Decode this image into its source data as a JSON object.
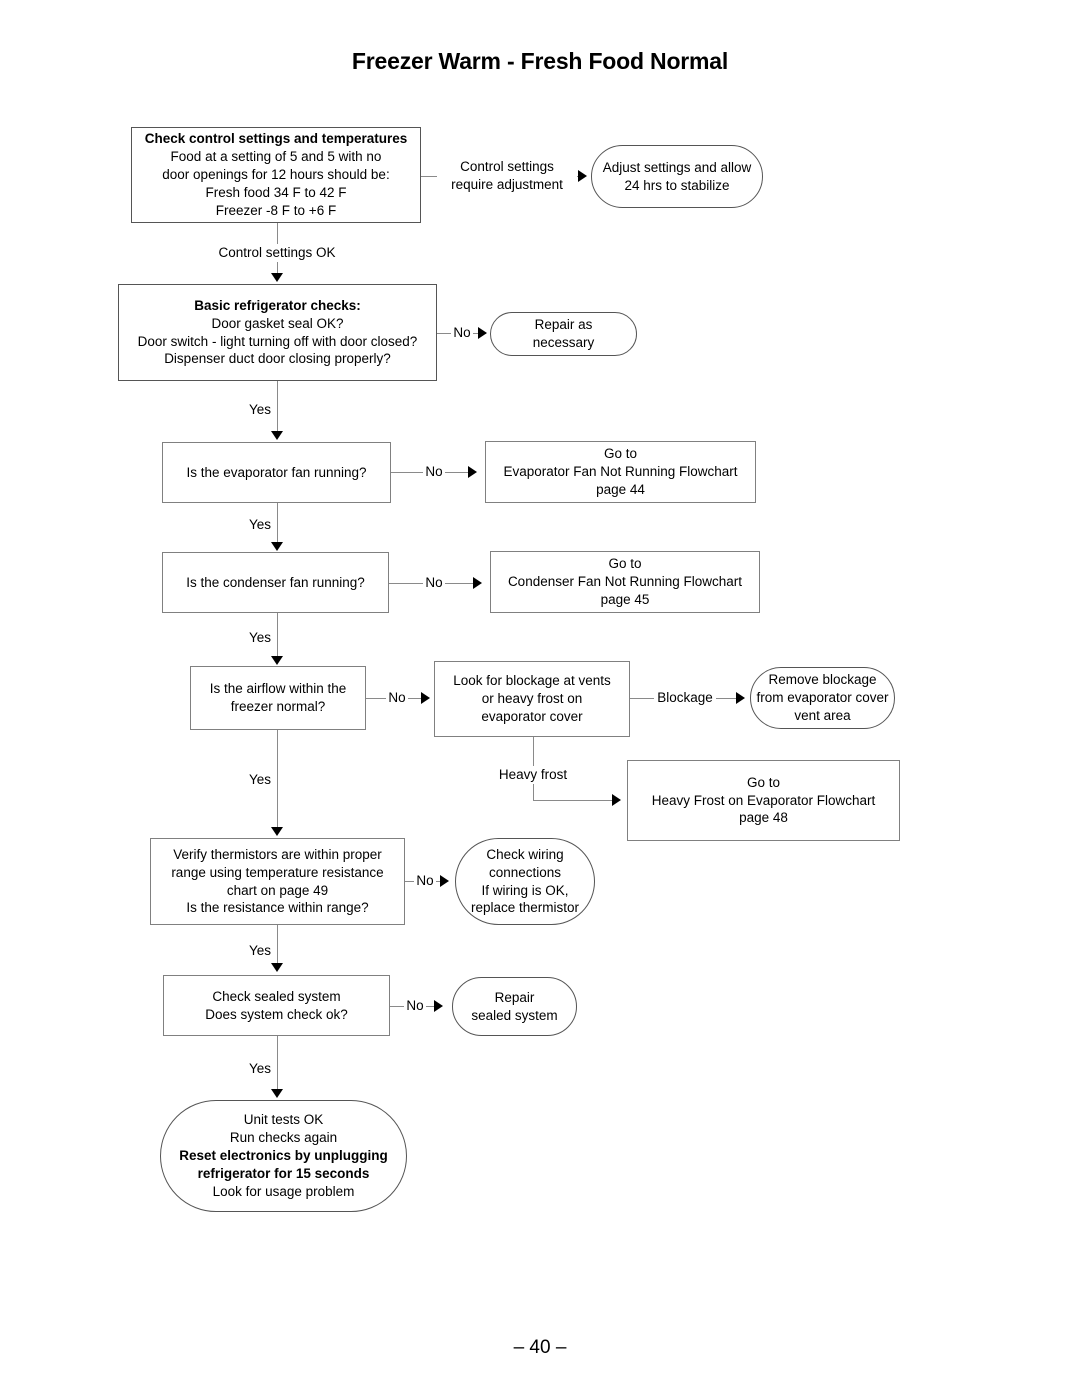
{
  "page": {
    "title": "Freezer Warm - Fresh Food Normal",
    "footer": "– 40 –"
  },
  "chart_data": {
    "type": "diagram",
    "diagram_type": "flowchart",
    "title": "Freezer Warm - Fresh Food Normal",
    "orientation": "top-to-bottom",
    "nodes": [
      {
        "id": "control-settings",
        "shape": "rect",
        "lines": [
          "Check control settings and temperatures",
          "Food at a setting of 5 and 5 with no",
          "door openings for 12 hours should be:",
          "Fresh food 34  F to 42  F",
          "Freezer -8  F to +6  F"
        ]
      },
      {
        "id": "adjust-settings",
        "shape": "oval",
        "lines": [
          "Adjust settings and allow",
          "24 hrs to stabilize"
        ]
      },
      {
        "id": "basic-checks",
        "shape": "rect",
        "lines": [
          "Basic refrigerator checks:",
          "Door gasket seal OK?",
          "Door switch - light turning off with door closed?",
          "Dispenser duct door closing properly?"
        ]
      },
      {
        "id": "repair-as-necessary",
        "shape": "oval",
        "lines": [
          "Repair as",
          "necessary"
        ]
      },
      {
        "id": "evaporator-fan",
        "shape": "rect",
        "lines": [
          "Is the evaporator fan running?"
        ]
      },
      {
        "id": "evaporator-flowchart",
        "shape": "rect",
        "lines": [
          "Go to",
          "Evaporator Fan Not Running Flowchart",
          "page 44"
        ]
      },
      {
        "id": "condenser-fan",
        "shape": "rect",
        "lines": [
          "Is the condenser fan running?"
        ]
      },
      {
        "id": "condenser-flowchart",
        "shape": "rect",
        "lines": [
          "Go to",
          "Condenser Fan Not Running Flowchart",
          "page 45"
        ]
      },
      {
        "id": "airflow",
        "shape": "rect",
        "lines": [
          "Is the airflow within the",
          "freezer normal?"
        ]
      },
      {
        "id": "look-for-blockage",
        "shape": "rect",
        "lines": [
          "Look for blockage at vents",
          "or heavy frost on",
          "evaporator cover"
        ]
      },
      {
        "id": "remove-blockage",
        "shape": "oval",
        "lines": [
          "Remove blockage",
          "from evaporator cover",
          "vent area"
        ]
      },
      {
        "id": "heavy-frost-flowchart",
        "shape": "rect",
        "lines": [
          "Go to",
          "Heavy Frost on Evaporator Flowchart",
          "page 48"
        ]
      },
      {
        "id": "verify-thermistors",
        "shape": "rect",
        "lines": [
          "Verify thermistors are within proper",
          "range using temperature resistance",
          "chart on page 49",
          "Is the resistance within range?"
        ]
      },
      {
        "id": "check-wiring",
        "shape": "oval",
        "lines": [
          "Check wiring",
          "connections",
          "If wiring is OK,",
          "replace thermistor"
        ]
      },
      {
        "id": "check-sealed-system",
        "shape": "rect",
        "lines": [
          "Check sealed system",
          "Does system check ok?"
        ]
      },
      {
        "id": "repair-sealed-system",
        "shape": "oval",
        "lines": [
          "Repair",
          "sealed system"
        ]
      },
      {
        "id": "unit-tests-ok",
        "shape": "oval",
        "lines": [
          "Unit tests OK",
          "Run checks again",
          "Reset electronics by unplugging",
          "refrigerator for 15 seconds",
          "Look for usage problem"
        ]
      }
    ],
    "edges": [
      {
        "from": "control-settings",
        "to": "adjust-settings",
        "label": "Control settings require adjustment"
      },
      {
        "from": "control-settings",
        "to": "basic-checks",
        "label": "Control settings OK"
      },
      {
        "from": "basic-checks",
        "to": "repair-as-necessary",
        "label": "No"
      },
      {
        "from": "basic-checks",
        "to": "evaporator-fan",
        "label": "Yes"
      },
      {
        "from": "evaporator-fan",
        "to": "evaporator-flowchart",
        "label": "No"
      },
      {
        "from": "evaporator-fan",
        "to": "condenser-fan",
        "label": "Yes"
      },
      {
        "from": "condenser-fan",
        "to": "condenser-flowchart",
        "label": "No"
      },
      {
        "from": "condenser-fan",
        "to": "airflow",
        "label": "Yes"
      },
      {
        "from": "airflow",
        "to": "look-for-blockage",
        "label": "No"
      },
      {
        "from": "look-for-blockage",
        "to": "remove-blockage",
        "label": "Blockage"
      },
      {
        "from": "look-for-blockage",
        "to": "heavy-frost-flowchart",
        "label": "Heavy frost"
      },
      {
        "from": "airflow",
        "to": "verify-thermistors",
        "label": "Yes"
      },
      {
        "from": "verify-thermistors",
        "to": "check-wiring",
        "label": "No"
      },
      {
        "from": "verify-thermistors",
        "to": "check-sealed-system",
        "label": "Yes"
      },
      {
        "from": "check-sealed-system",
        "to": "repair-sealed-system",
        "label": "No"
      },
      {
        "from": "check-sealed-system",
        "to": "unit-tests-ok",
        "label": "Yes"
      }
    ]
  },
  "nodes": {
    "control_settings": {
      "l1": "Check control settings and temperatures",
      "l2": "Food at a setting of 5 and 5 with no",
      "l3": "door openings for 12 hours should be:",
      "l4": "Fresh food 34  F to 42  F",
      "l5": "Freezer -8  F to +6  F"
    },
    "adjust_settings": {
      "l1": "Adjust settings and allow",
      "l2": "24 hrs to stabilize"
    },
    "basic_checks": {
      "l1": "Basic refrigerator checks:",
      "l2": "Door gasket seal OK?",
      "l3": "Door switch - light turning off with door closed?",
      "l4": "Dispenser duct door closing properly?"
    },
    "repair_as_necessary": {
      "l1": "Repair as",
      "l2": "necessary"
    },
    "evaporator_fan": {
      "l1": "Is the evaporator fan running?"
    },
    "evaporator_flowchart": {
      "l1": "Go to",
      "l2": "Evaporator Fan Not Running Flowchart",
      "l3": "page 44"
    },
    "condenser_fan": {
      "l1": "Is the condenser fan running?"
    },
    "condenser_flowchart": {
      "l1": "Go to",
      "l2": "Condenser Fan Not Running Flowchart",
      "l3": "page 45"
    },
    "airflow": {
      "l1": "Is the airflow within the",
      "l2": "freezer normal?"
    },
    "look_for_blockage": {
      "l1": "Look for blockage at vents",
      "l2": "or heavy frost on",
      "l3": "evaporator cover"
    },
    "remove_blockage": {
      "l1": "Remove blockage",
      "l2": "from evaporator cover",
      "l3": "vent area"
    },
    "heavy_frost_flowchart": {
      "l1": "Go to",
      "l2": "Heavy Frost on Evaporator Flowchart",
      "l3": "page 48"
    },
    "verify_thermistors": {
      "l1": "Verify thermistors are within proper",
      "l2": "range using temperature resistance",
      "l3": "chart on page 49",
      "l4": "Is the resistance within range?"
    },
    "check_wiring": {
      "l1": "Check wiring",
      "l2": "connections",
      "l3": "If wiring is OK,",
      "l4": "replace thermistor"
    },
    "check_sealed_system": {
      "l1": "Check sealed system",
      "l2": "Does system check ok?"
    },
    "repair_sealed_system": {
      "l1": "Repair",
      "l2": "sealed system"
    },
    "unit_tests_ok": {
      "l1": "Unit tests OK",
      "l2": "Run checks again",
      "l3": "Reset electronics by unplugging",
      "l4": "refrigerator for 15 seconds",
      "l5": "Look for usage problem"
    }
  },
  "labels": {
    "control_settings_require_adjustment_1": "Control settings",
    "control_settings_require_adjustment_2": "require adjustment",
    "control_settings_ok": "Control settings OK",
    "no_basic": "No",
    "yes_basic": "Yes",
    "no_evap": "No",
    "yes_evap": "Yes",
    "no_cond": "No",
    "yes_cond": "Yes",
    "no_airflow": "No",
    "blockage": "Blockage",
    "heavy_frost": "Heavy frost",
    "yes_airflow": "Yes",
    "no_thermistor": "No",
    "yes_thermistor": "Yes",
    "no_sealed": "No",
    "yes_sealed": "Yes"
  }
}
